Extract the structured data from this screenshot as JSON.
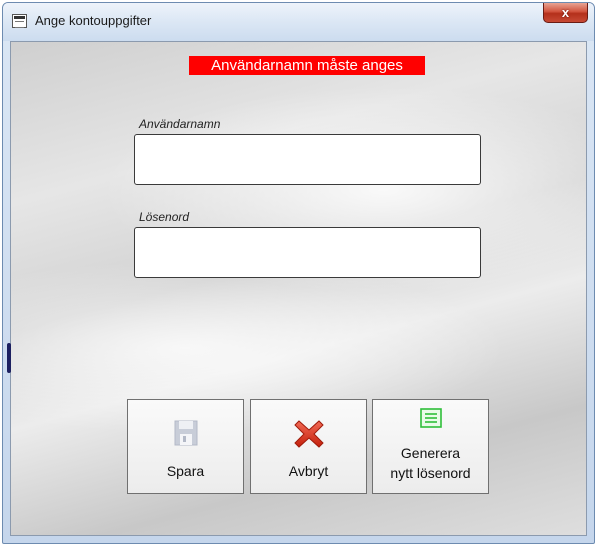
{
  "window": {
    "title": "Ange kontouppgifter",
    "close_label": "x"
  },
  "error": {
    "message": "Användarnamn måste anges",
    "color": "#ff0000"
  },
  "form": {
    "username": {
      "label": "Användarnamn",
      "value": ""
    },
    "password": {
      "label": "Lösenord",
      "value": ""
    }
  },
  "buttons": {
    "save": {
      "label": "Spara",
      "icon": "floppy-disk-icon",
      "enabled": false
    },
    "cancel": {
      "label": "Avbryt",
      "icon": "red-x-icon"
    },
    "generate": {
      "label_line1": "Generera",
      "label_line2": "nytt lösenord",
      "icon": "document-lines-icon"
    }
  }
}
